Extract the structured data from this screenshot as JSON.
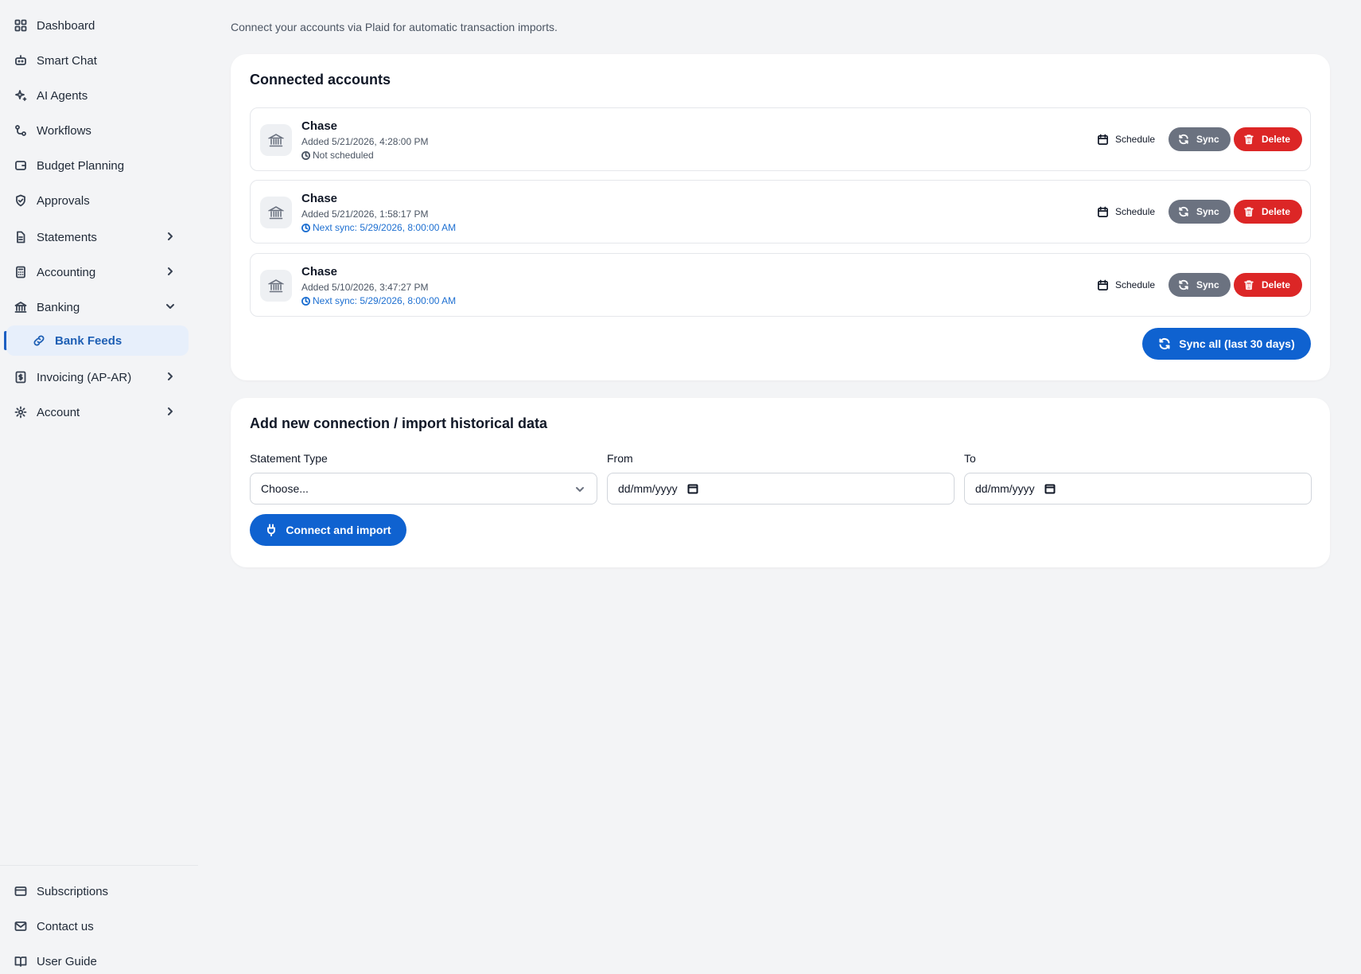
{
  "sidebar": {
    "items": [
      {
        "label": "Dashboard",
        "icon": "grid-icon"
      },
      {
        "label": "Smart Chat",
        "icon": "bot-icon"
      },
      {
        "label": "AI Agents",
        "icon": "sparkles-icon"
      },
      {
        "label": "Workflows",
        "icon": "workflow-icon"
      },
      {
        "label": "Budget Planning",
        "icon": "wallet-icon"
      },
      {
        "label": "Approvals",
        "icon": "shield-check-icon"
      },
      {
        "label": "Statements",
        "icon": "file-text-icon"
      },
      {
        "label": "Accounting",
        "icon": "calculator-icon"
      },
      {
        "label": "Banking",
        "icon": "bank-icon"
      },
      {
        "label": "Bank Feeds",
        "icon": "link-icon"
      },
      {
        "label": "Invoicing (AP-AR)",
        "icon": "receipt-dollar-icon"
      },
      {
        "label": "Account",
        "icon": "gear-icon"
      }
    ],
    "bottom": [
      {
        "label": "Subscriptions",
        "icon": "credit-card-icon"
      },
      {
        "label": "Contact us",
        "icon": "mail-icon"
      },
      {
        "label": "User Guide",
        "icon": "book-icon"
      }
    ]
  },
  "main": {
    "subtitle": "Connect your accounts via Plaid for automatic transaction imports.",
    "connected": {
      "title": "Connected accounts",
      "accounts": [
        {
          "name": "Chase",
          "added": "Added 5/21/2026, 4:28:00 PM",
          "schedule": "Not scheduled"
        },
        {
          "name": "Chase",
          "added": "Added 5/21/2026, 1:58:17 PM",
          "schedule": "Next sync: 5/29/2026, 8:00:00 AM"
        },
        {
          "name": "Chase",
          "added": "Added 5/10/2026, 3:47:27 PM",
          "schedule": "Next sync: 5/29/2026, 8:00:00 AM"
        }
      ],
      "schedule_label": "Schedule",
      "sync_label": "Sync",
      "delete_label": "Delete",
      "sync_all_label": "Sync all (last 30 days)"
    },
    "import": {
      "title": "Add new connection / import historical data",
      "statement_type_label": "Statement Type",
      "statement_type_value": "Choose...",
      "from_label": "From",
      "from_value": "dd/mm/yyyy",
      "to_label": "To",
      "to_value": "dd/mm/yyyy",
      "connect_label": "Connect and import"
    }
  },
  "colors": {
    "accent": "#0f62d0",
    "danger": "#dc2626",
    "neutral_button": "#6b7280",
    "active_bg": "#e7effb",
    "link_blue": "#1d6fd1"
  }
}
